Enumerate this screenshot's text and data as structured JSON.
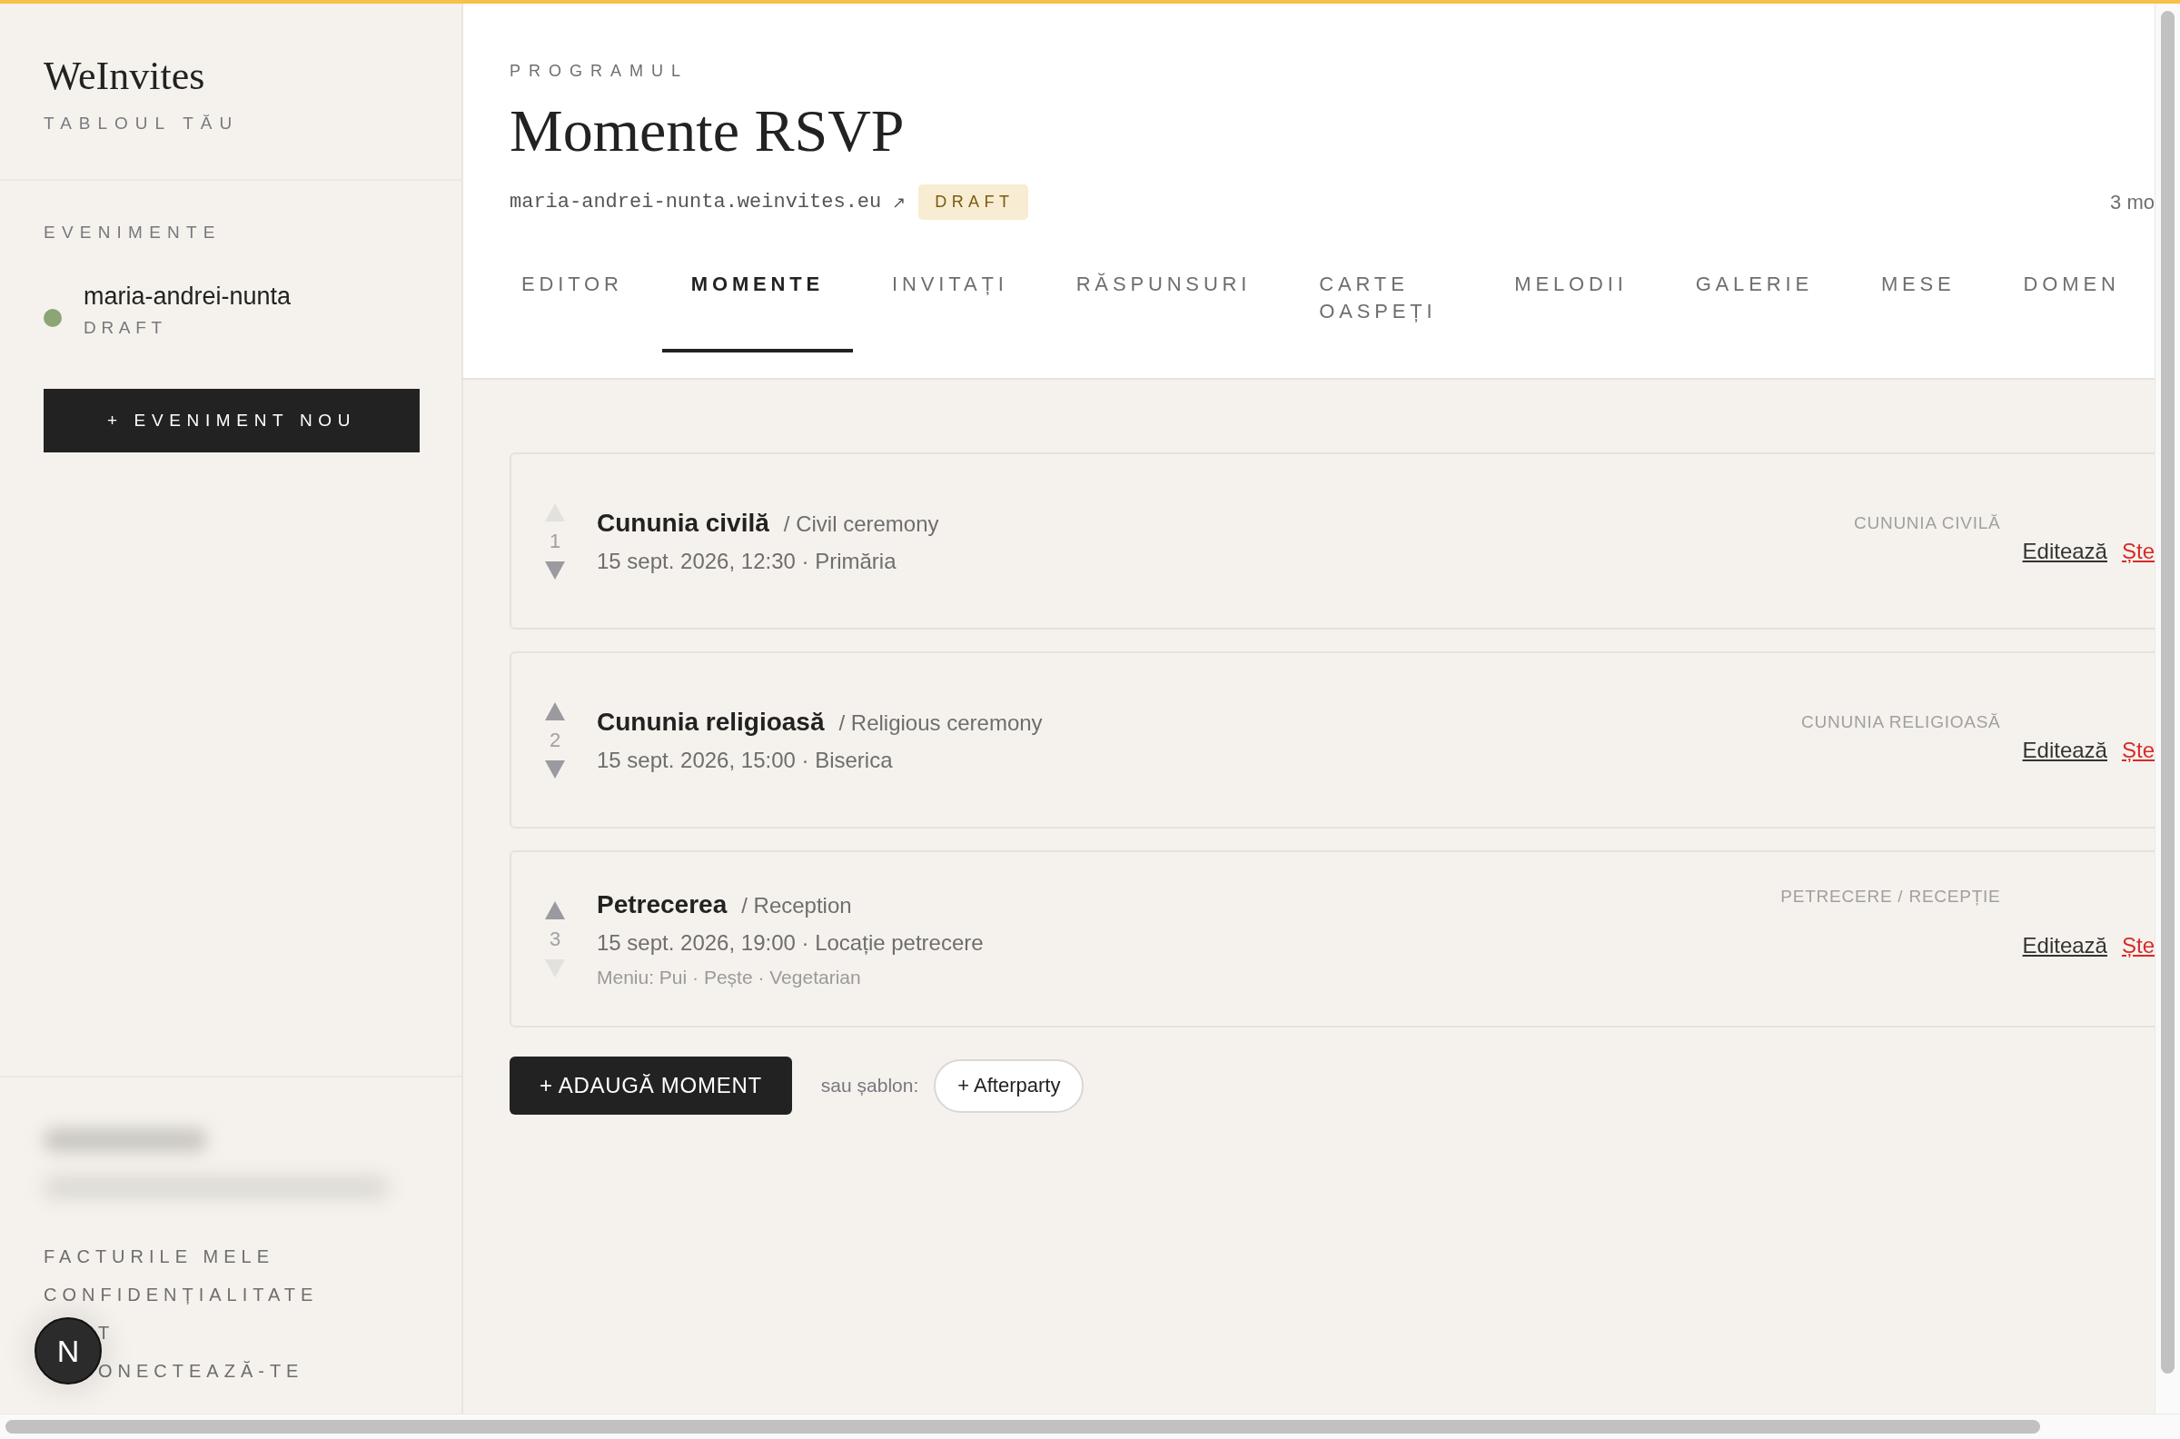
{
  "sidebar": {
    "logo": "WeInvites",
    "subtitle": "TABLOUL TĂU",
    "section_label": "EVENIMENTE",
    "events": [
      {
        "name": "maria-andrei-nunta",
        "status": "DRAFT",
        "color": "#8ba577"
      }
    ],
    "new_event_button": "+ EVENIMENT NOU",
    "footer_links": [
      {
        "label": "FACTURILE MELE",
        "kind": "link"
      },
      {
        "label": "CONFIDENȚIALITATE",
        "kind": "link"
      },
      {
        "label": "T",
        "kind": "covered"
      },
      {
        "label": "ONECTEAZĂ-TE",
        "kind": "covered"
      }
    ],
    "floating_button": "N"
  },
  "header": {
    "eyebrow": "PROGRAMUL",
    "title": "Momente RSVP",
    "site_url": "maria-andrei-nunta.weinvites.eu",
    "external_link_icon": "↗",
    "status_badge": "DRAFT",
    "updated": "3 mo"
  },
  "tabs": [
    {
      "label": "EDITOR",
      "selected": false
    },
    {
      "label": "MOMENTE",
      "selected": true
    },
    {
      "label": "INVITAȚI",
      "selected": false
    },
    {
      "label": "RĂSPUNSURI",
      "selected": false
    },
    {
      "label": "CARTE OASPEȚI",
      "selected": false
    },
    {
      "label": "MELODII",
      "selected": false
    },
    {
      "label": "GALERIE",
      "selected": false
    },
    {
      "label": "MESE",
      "selected": false
    },
    {
      "label": "DOMEN",
      "selected": false
    }
  ],
  "moments": [
    {
      "number": "1",
      "title": "Cununia civilă",
      "subtitle": "/ Civil ceremony",
      "when": "15 sept. 2026, 12:30 · Primăria",
      "tag": "CUNUNIA CIVILĂ",
      "edit": "Editează",
      "delete": "Ște",
      "up_enabled": false,
      "down_enabled": true
    },
    {
      "number": "2",
      "title": "Cununia religioasă",
      "subtitle": "/ Religious ceremony",
      "when": "15 sept. 2026, 15:00 · Biserica",
      "tag": "CUNUNIA RELIGIOASĂ",
      "edit": "Editează",
      "delete": "Ște",
      "up_enabled": true,
      "down_enabled": true
    },
    {
      "number": "3",
      "title": "Petrecerea",
      "subtitle": "/ Reception",
      "when": "15 sept. 2026, 19:00 · Locație petrecere",
      "menu": "Meniu: Pui · Pește · Vegetarian",
      "tag": "PETRECERE / RECEPȚIE",
      "edit": "Editează",
      "delete": "Ște",
      "up_enabled": true,
      "down_enabled": false
    }
  ],
  "add_button": "+ ADAUGĂ MOMENT",
  "template_label": "sau șablon:",
  "templates": [
    "+ Afterparty"
  ]
}
